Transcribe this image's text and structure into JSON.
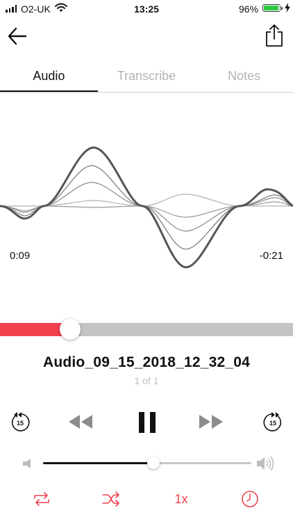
{
  "status_bar": {
    "carrier": "O2-UK",
    "time": "13:25",
    "battery_percent": "96%",
    "battery_level": 0.96,
    "icons": [
      "signal-bars-icon",
      "wifi-icon",
      "battery-icon",
      "charging-bolt-icon"
    ]
  },
  "nav": {
    "back_icon": "arrow-left-icon",
    "share_icon": "share-icon"
  },
  "tabs": [
    {
      "label": "Audio",
      "active": true
    },
    {
      "label": "Transcribe",
      "active": false
    },
    {
      "label": "Notes",
      "active": false
    }
  ],
  "player": {
    "elapsed": "0:09",
    "remaining": "-0:21",
    "progress": 0.24,
    "track_title": "Audio_09_15_2018_12_32_04",
    "track_index": "1 of 1",
    "skip_back_seconds": "15",
    "skip_forward_seconds": "15",
    "volume": 0.53,
    "speed_label": "1x",
    "icons": [
      "skip-back-15-icon",
      "rewind-icon",
      "pause-icon",
      "fast-forward-icon",
      "skip-forward-15-icon",
      "volume-low-icon",
      "volume-high-icon",
      "repeat-icon",
      "shuffle-icon",
      "timer-icon"
    ]
  },
  "colors": {
    "accent": "#f2404e",
    "track_bg": "#c4c4c4",
    "text": "#111111",
    "muted": "#b3b3b3",
    "battery": "#2ecc40"
  }
}
